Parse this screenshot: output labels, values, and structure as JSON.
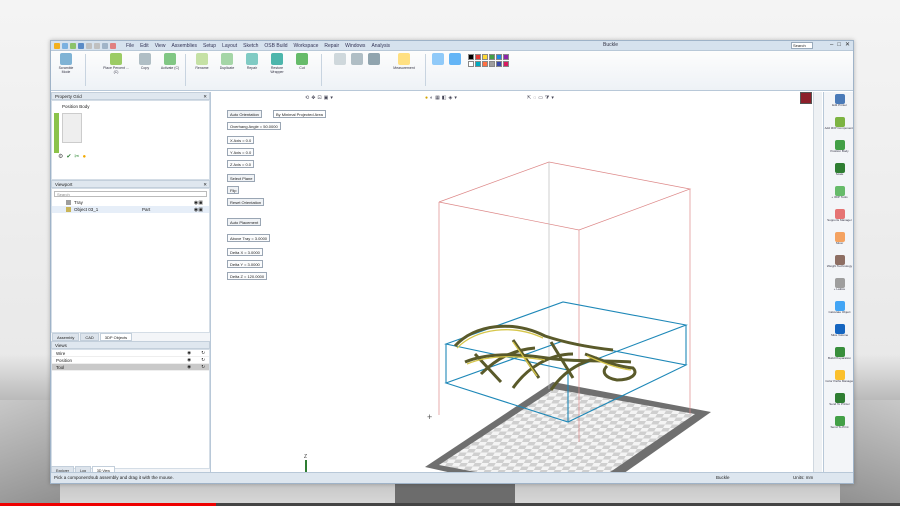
{
  "app": {
    "title": "Buckle",
    "search_placeholder": "Search"
  },
  "menu": [
    "File",
    "Edit",
    "View",
    "Assemblies",
    "Setup",
    "Layout",
    "Sketch",
    "OSB Build",
    "Workspace",
    "Repair",
    "Windows",
    "Analysis"
  ],
  "ribbon": {
    "groups": [
      {
        "label": "Scramble Mode"
      },
      {
        "label": "Place Percent ...(C)"
      },
      {
        "label": "Copy"
      },
      {
        "label": "Activate (C)"
      },
      {
        "label": "Rename"
      },
      {
        "label": "Duplicate"
      },
      {
        "label": "Repair"
      },
      {
        "label": "Restore Wrapper"
      },
      {
        "label": "Cut"
      },
      {
        "label": "Measurement"
      }
    ]
  },
  "left_panel": {
    "property_header": "Property Grid",
    "property_item": "Position Body",
    "objects_header": "Viewport",
    "filter_placeholder": "Search",
    "tree": [
      {
        "name": "Tray",
        "type": ""
      },
      {
        "name": "Object 03_1",
        "type": "Part"
      }
    ],
    "tabs": [
      "Assembly",
      "CAD",
      "3DP Objects"
    ],
    "views_header": "Views",
    "views": [
      {
        "name": "Wire"
      },
      {
        "name": "Position"
      },
      {
        "name": "Tool"
      }
    ],
    "bottom_tabs": [
      "Explorer",
      "Log",
      "3D View"
    ]
  },
  "orientation_panel": {
    "auto_orientation": "Auto Orientation",
    "method": "By Minimal Projected Area",
    "overhang": "Overhang Angle = 50.0000",
    "x_axis": "X Axis = 0.0",
    "y_axis": "Y Axis = 0.0",
    "z_axis": "Z Axis = 0.0",
    "select_plane": "Select Plane",
    "flip": "Flip",
    "reset": "Reset Orientation",
    "auto_placement": "Auto Placement",
    "above_tray": "Above Tray = 3.0000",
    "delta_x": "Delta X = 3.0000",
    "delta_y": "Delta Y = 3.0000",
    "delta_z": "Delta Z = 120.0000"
  },
  "right_toolbar": [
    {
      "label": "Edit Printer",
      "color": "#4a7ab8"
    },
    {
      "label": "Add 3DP Components",
      "color": "#7cb342"
    },
    {
      "label": "Position Body",
      "color": "#43a047"
    },
    {
      "label": "Scale",
      "color": "#2e7d32"
    },
    {
      "label": "+ 3DP Tools",
      "color": "#66bb6a"
    },
    {
      "label": "Supports Manager",
      "color": "#e57373"
    },
    {
      "label": "Slicer",
      "color": "#f4a261"
    },
    {
      "label": "Weight Technology",
      "color": "#8d6e63"
    },
    {
      "label": "+ Lattice",
      "color": "#9e9e9e"
    },
    {
      "label": "Calculate Object",
      "color": "#42a5f5"
    },
    {
      "label": "Slice Volume",
      "color": "#1565c0"
    },
    {
      "label": "Build Preparation",
      "color": "#388e3c"
    },
    {
      "label": "Color Paths Manager",
      "color": "#fbc02d"
    },
    {
      "label": "Send To Printer",
      "color": "#2e7d32"
    },
    {
      "label": "Send To Print",
      "color": "#43a047"
    }
  ],
  "status": {
    "hint": "Pick a component/sub assembly and drag it with the mouse.",
    "mode": "Buckle",
    "units": "Units: mm"
  },
  "colors": {
    "accent": "#1e88b8",
    "model": "#6b6b3a",
    "bbox_outer": "#d46a6a"
  },
  "video": {
    "progress_fraction": 0.24
  }
}
